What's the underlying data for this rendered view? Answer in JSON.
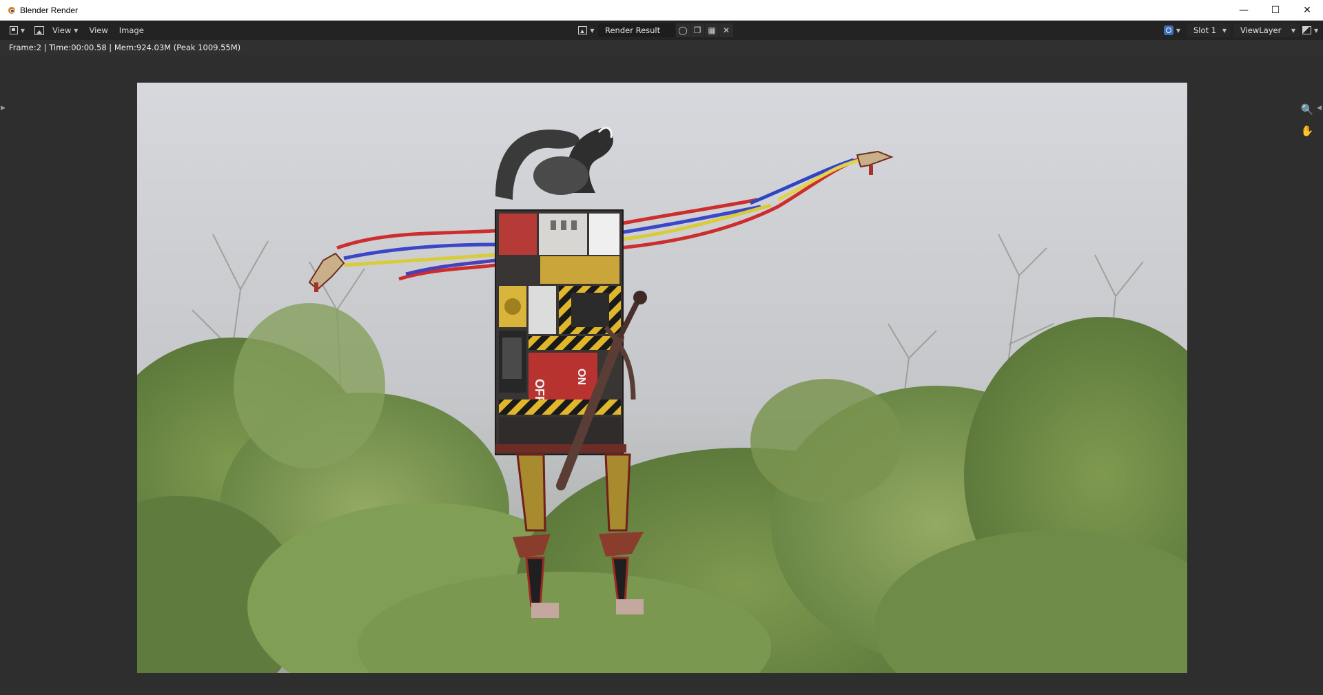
{
  "window": {
    "title": "Blender Render",
    "controls": [
      "minimize-icon",
      "maximize-icon",
      "close-icon"
    ]
  },
  "header": {
    "menus": [
      "View",
      "View",
      "Image"
    ],
    "image_name": "Render Result",
    "slot": "Slot 1",
    "view_layer": "ViewLayer",
    "icons": [
      "editor-type-icon",
      "image-mode-icon",
      "image-browse-icon",
      "fake-user-shield-icon",
      "new-image-icon",
      "open-folder-icon",
      "unlink-close-icon",
      "render-pass-icon",
      "display-channels-icon"
    ]
  },
  "info": {
    "status": "Frame:2 | Time:00:00.58 | Mem:924.03M (Peak 1009.55M)"
  },
  "viewport": {
    "gizmos": [
      "zoom-icon",
      "hand-pan-icon"
    ],
    "render_content": {
      "text_on_robot_off": "OFF",
      "text_on_robot_on": "ON"
    }
  },
  "colors": {
    "titlebar": "#ffffff",
    "header": "#232323",
    "viewport": "#2e2e2e",
    "accent_blue": "#3d6fb6",
    "blender_orange": "#e87d0d"
  }
}
